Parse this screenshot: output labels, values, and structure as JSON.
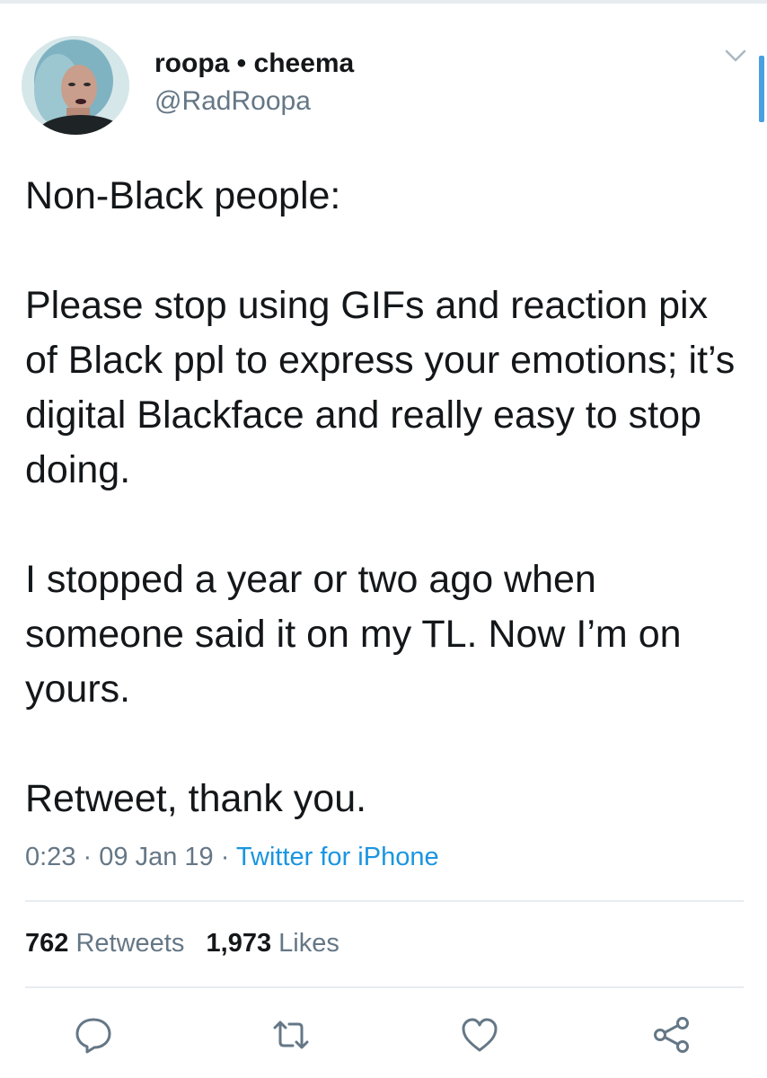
{
  "tweet": {
    "author": {
      "display_name": "roopa • cheema",
      "handle": "@RadRoopa"
    },
    "text_paragraphs": [
      "Non-Black people:",
      "Please stop using GIFs and reaction pix of Black ppl to express your emotions; it’s digital Blackface and really easy to stop doing.",
      "I stopped a year or two ago when someone said it on my TL. Now I’m on yours.",
      "Retweet, thank you."
    ],
    "time": "0:23",
    "date": "09 Jan 19",
    "separator": "·",
    "source": "Twitter for iPhone",
    "stats": {
      "retweets_count": "762",
      "retweets_label": "Retweets",
      "likes_count": "1,973",
      "likes_label": "Likes"
    }
  },
  "actions": [
    {
      "icon": "reply-icon"
    },
    {
      "icon": "retweet-icon"
    },
    {
      "icon": "like-icon"
    },
    {
      "icon": "share-icon"
    }
  ],
  "colors": {
    "text": "#14171a",
    "secondary": "#657786",
    "link": "#1b95e0",
    "divider": "#e6ecf0"
  }
}
